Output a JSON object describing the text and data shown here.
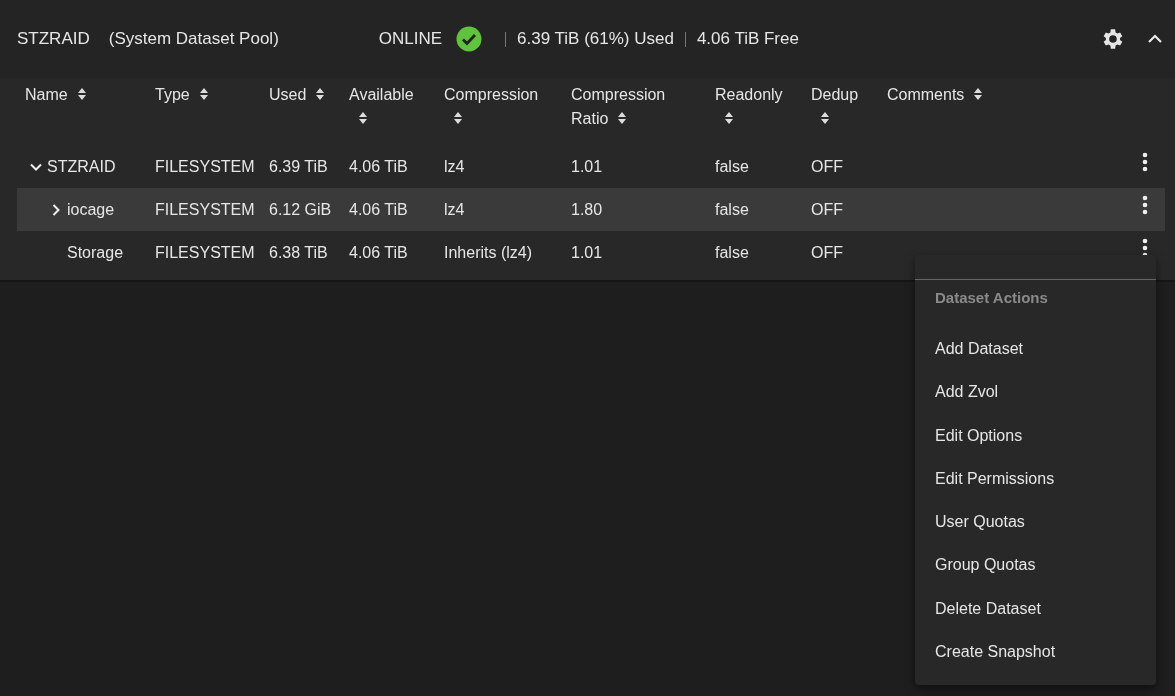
{
  "pool": {
    "name": "STZRAID",
    "description": "(System Dataset Pool)",
    "status": "ONLINE",
    "used": "6.39 TiB (61%) Used",
    "free": "4.06 TiB Free",
    "expanded": true
  },
  "table": {
    "columns": [
      {
        "label": "Name"
      },
      {
        "label": "Type"
      },
      {
        "label": "Used"
      },
      {
        "label": "Available"
      },
      {
        "label": "Compression"
      },
      {
        "label": "Compression Ratio"
      },
      {
        "label": "Readonly"
      },
      {
        "label": "Dedup"
      },
      {
        "label": "Comments"
      }
    ],
    "rows": [
      {
        "name": "STZRAID",
        "type": "FILESYSTEM",
        "used": "6.39 TiB",
        "available": "4.06 TiB",
        "compression": "lz4",
        "ratio": "1.01",
        "readonly": "false",
        "dedup": "OFF",
        "selected": false,
        "expanded": true,
        "children": [
          {
            "name": "iocage",
            "type": "FILESYSTEM",
            "used": "6.12 GiB",
            "available": "4.06 TiB",
            "compression": "lz4",
            "ratio": "1.80",
            "readonly": "false",
            "dedup": "OFF",
            "selected": true,
            "expanded": false
          },
          {
            "name": "Storage",
            "type": "FILESYSTEM",
            "used": "6.38 TiB",
            "available": "4.06 TiB",
            "compression": "Inherits (lz4)",
            "ratio": "1.01",
            "readonly": "false",
            "dedup": "OFF",
            "selected": false
          }
        ]
      }
    ]
  },
  "menu": {
    "title": "Dataset Actions",
    "items": [
      {
        "label": "Add Dataset"
      },
      {
        "label": "Add Zvol"
      },
      {
        "label": "Edit Options"
      },
      {
        "label": "Edit Permissions"
      },
      {
        "label": "User Quotas"
      },
      {
        "label": "Group Quotas"
      },
      {
        "label": "Delete Dataset"
      },
      {
        "label": "Create Snapshot"
      }
    ]
  }
}
